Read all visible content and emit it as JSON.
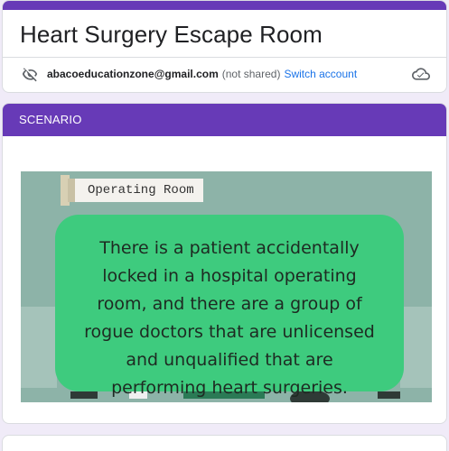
{
  "form": {
    "title": "Heart Surgery Escape Room",
    "account_email": "abacoeducationzone@gmail.com",
    "not_shared": "(not shared)",
    "switch_account": "Switch account",
    "accent_color": "#673ab7"
  },
  "section": {
    "title": "SCENARIO",
    "image": {
      "sign_label": "Operating Room",
      "caption": "There is a patient accidentally locked in a hospital operating room, and there are a group of rogue doctors that are unlicensed and unqualified that are performing heart surgeries."
    }
  },
  "icons": {
    "privacy": "eye-off-icon",
    "cloud": "cloud-saved-icon"
  }
}
